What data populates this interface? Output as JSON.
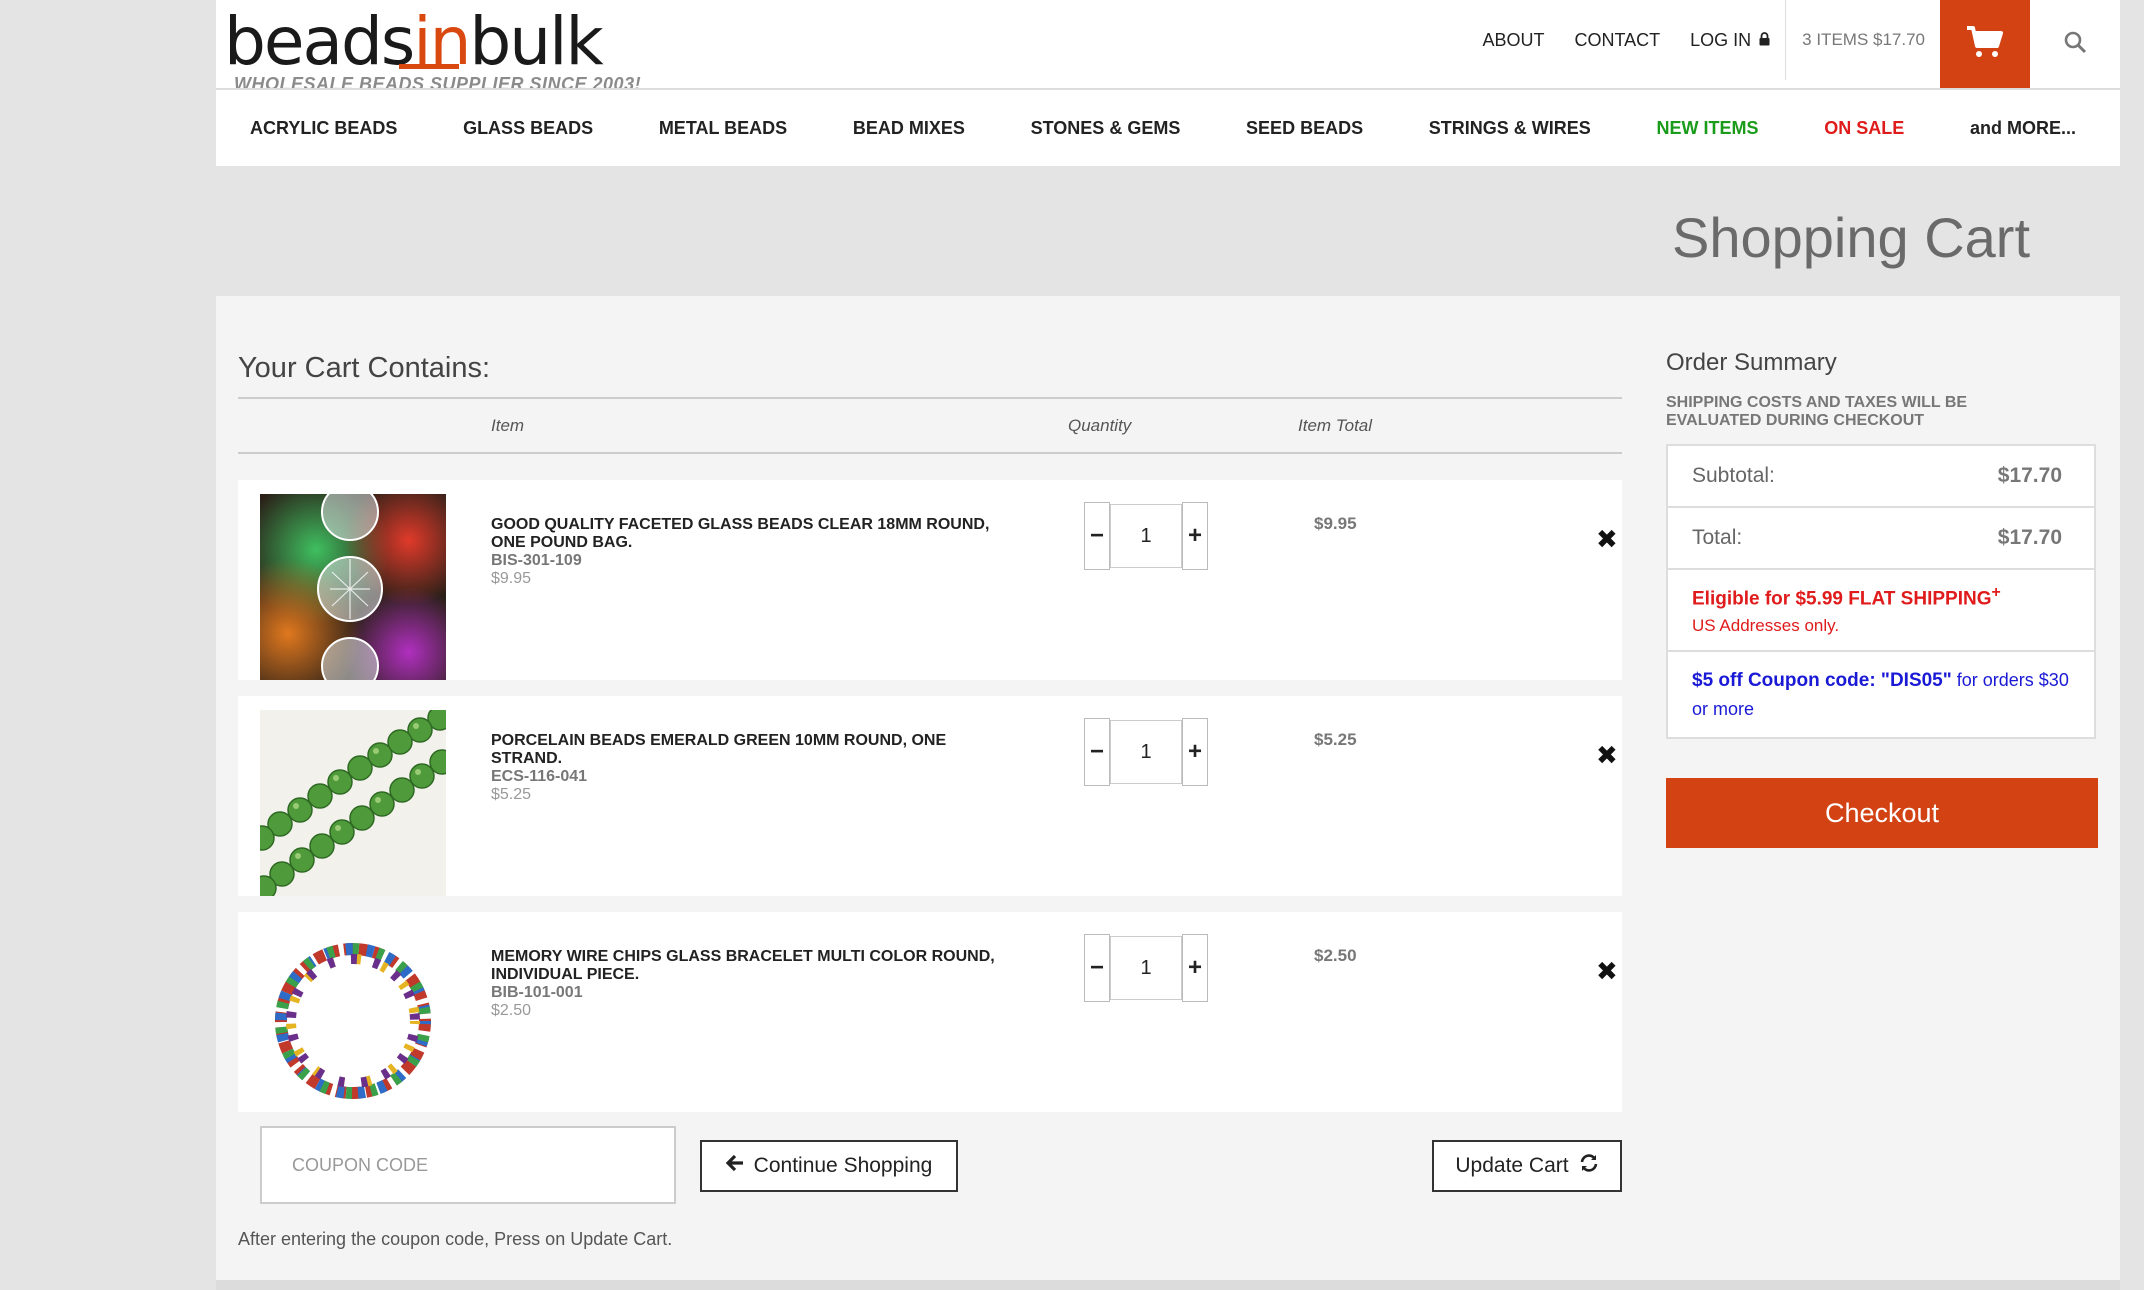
{
  "logo": {
    "word_a": "beads",
    "word_in": "in",
    "word_b": "bulk",
    "tagline": "WHOLESALE BEADS SUPPLIER SINCE 2003!"
  },
  "topnav": {
    "about": "ABOUT",
    "contact": "CONTACT",
    "login": "LOG IN",
    "cart_summary": "3 ITEMS $17.70"
  },
  "icons": {
    "lock": "lock-icon",
    "cart": "cart-icon",
    "search": "search-icon",
    "remove": "close-icon",
    "refresh": "refresh-icon",
    "back": "arrow-left-icon"
  },
  "mainnav": [
    "ACRYLIC BEADS",
    "GLASS BEADS",
    "METAL BEADS",
    "BEAD MIXES",
    "STONES & GEMS",
    "SEED BEADS",
    "STRINGS & WIRES",
    "NEW ITEMS",
    "ON SALE",
    "and MORE..."
  ],
  "page_title": "Shopping Cart",
  "cart": {
    "heading": "Your Cart Contains:",
    "col_item": "Item",
    "col_quantity": "Quantity",
    "col_total": "Item Total",
    "items": [
      {
        "name": "GOOD QUALITY FACETED GLASS BEADS CLEAR 18MM ROUND, ONE POUND BAG.",
        "sku": "BIS-301-109",
        "price": "$9.95",
        "qty": "1",
        "total": "$9.95"
      },
      {
        "name": "PORCELAIN BEADS EMERALD GREEN 10MM ROUND, ONE STRAND.",
        "sku": "ECS-116-041",
        "price": "$5.25",
        "qty": "1",
        "total": "$5.25"
      },
      {
        "name": "MEMORY WIRE CHIPS GLASS BRACELET MULTI COLOR ROUND, INDIVIDUAL PIECE.",
        "sku": "BIB-101-001",
        "price": "$2.50",
        "qty": "1",
        "total": "$2.50"
      }
    ],
    "coupon_placeholder": "COUPON CODE",
    "continue_label": "Continue Shopping",
    "update_label": "Update Cart",
    "footnote": "After entering the coupon code, Press on Update Cart."
  },
  "summary": {
    "heading": "Order Summary",
    "note": "SHIPPING COSTS AND TAXES WILL BE EVALUATED DURING CHECKOUT",
    "subtotal_label": "Subtotal:",
    "subtotal_value": "$17.70",
    "total_label": "Total:",
    "total_value": "$17.70",
    "shipping_line": "Eligible for $5.99 FLAT SHIPPING",
    "shipping_mark": "+",
    "shipping_sub": "US Addresses only.",
    "coupon_bold": "$5 off Coupon code: \"DIS05\"",
    "coupon_rest": " for orders $30 or more",
    "checkout_label": "Checkout"
  },
  "colors": {
    "accent": "#d34213",
    "new": "#1a9b1a",
    "sale": "#e01b1b",
    "coupon": "#1a1ad6"
  }
}
